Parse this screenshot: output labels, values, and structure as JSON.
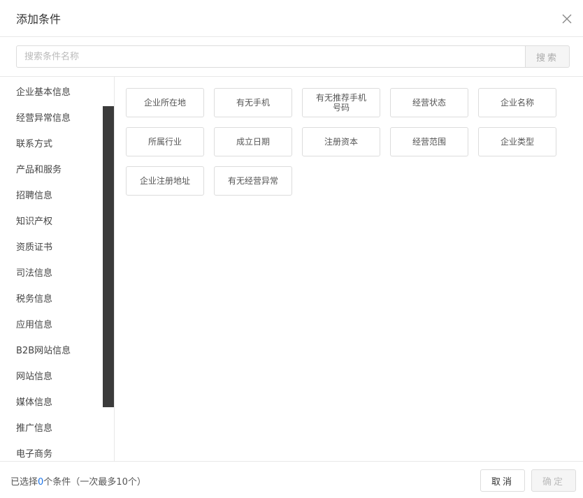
{
  "dialog": {
    "title": "添加条件",
    "close_icon": "close-icon"
  },
  "search": {
    "placeholder": "搜索条件名称",
    "value": "",
    "button_label": "搜索"
  },
  "sidebar": {
    "items": [
      {
        "label": "企业基本信息"
      },
      {
        "label": "经营异常信息"
      },
      {
        "label": "联系方式"
      },
      {
        "label": "产品和服务"
      },
      {
        "label": "招聘信息"
      },
      {
        "label": "知识产权"
      },
      {
        "label": "资质证书"
      },
      {
        "label": "司法信息"
      },
      {
        "label": "税务信息"
      },
      {
        "label": "应用信息"
      },
      {
        "label": "B2B网站信息"
      },
      {
        "label": "网站信息"
      },
      {
        "label": "媒体信息"
      },
      {
        "label": "推广信息"
      },
      {
        "label": "电子商务"
      }
    ]
  },
  "options": [
    {
      "label": "企业所在地"
    },
    {
      "label": "有无手机"
    },
    {
      "label": "有无推荐手机号码"
    },
    {
      "label": "经营状态"
    },
    {
      "label": "企业名称"
    },
    {
      "label": "所属行业"
    },
    {
      "label": "成立日期"
    },
    {
      "label": "注册资本"
    },
    {
      "label": "经营范围"
    },
    {
      "label": "企业类型"
    },
    {
      "label": "企业注册地址"
    },
    {
      "label": "有无经营异常"
    }
  ],
  "footer": {
    "status_prefix": "已选择",
    "selected_count": "0",
    "status_suffix": "个条件（一次最多10个）",
    "cancel_label": "取消",
    "confirm_label": "确定"
  },
  "colors": {
    "accent": "#1a73e8",
    "scrollbar": "#3b3b3b",
    "border": "#dcdcdc"
  }
}
